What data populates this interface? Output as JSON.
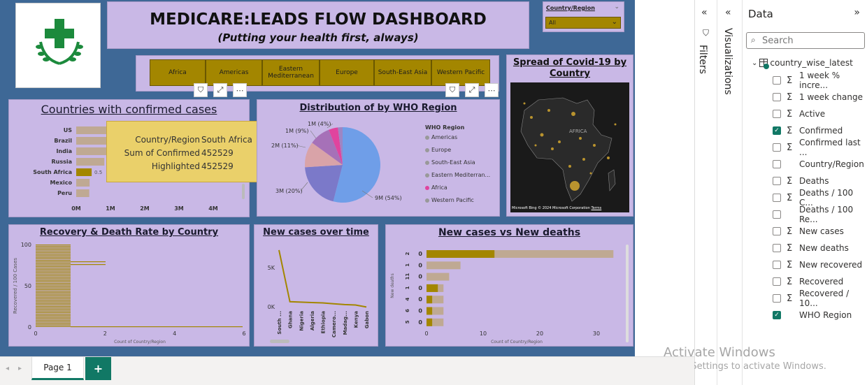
{
  "header": {
    "title": "MEDICARE:LEADS FLOW DASHBOARD",
    "subtitle": "(Putting your health first, always)"
  },
  "slicer": {
    "label": "Country/Region",
    "value": "All"
  },
  "regions": [
    "Africa",
    "Americas",
    "Eastern Mediterranean",
    "Europe",
    "South-East Asia",
    "Western Pacific"
  ],
  "map": {
    "title": "Spread of Covid-19 by Country",
    "map_label": "AFRICA",
    "credit": "Microsoft Bing",
    "copyright": "© 2024 Microsoft Corporation",
    "terms": "Terms"
  },
  "countries_chart": {
    "title": "Countries with confirmed cases",
    "type": "bar",
    "categories": [
      "US",
      "Brazil",
      "India",
      "Russia",
      "South Africa",
      "Mexico",
      "Peru"
    ],
    "ticks": [
      "0M",
      "1M",
      "2M",
      "3M",
      "4M"
    ],
    "highlight_label": "0.5",
    "tooltip": {
      "k1": "Country/Region",
      "v1": "South Africa",
      "k2": "Sum of Confirmed",
      "v2": "452529",
      "k3": "Highlighted",
      "v3": "452529"
    }
  },
  "pie_chart": {
    "title": "Distribution of by WHO Region",
    "legend_title": "WHO Region",
    "legend": [
      "Americas",
      "Europe",
      "South-East Asia",
      "Eastern Mediterran...",
      "Africa",
      "Western Pacific"
    ],
    "labels": [
      "1M (4%)",
      "1M (9%)",
      "2M (11%)",
      "3M (20%)",
      "9M (54%)"
    ]
  },
  "recovery_chart": {
    "title": "Recovery & Death Rate by Country",
    "ylabel": "Recovered / 100 Cases",
    "xlabel": "Count of Country/Region",
    "yticks": [
      "100",
      "50",
      "0"
    ],
    "xticks": [
      "0",
      "2",
      "4",
      "6"
    ]
  },
  "line_chart": {
    "title": "New cases over time",
    "yticks": [
      "5K",
      "0K"
    ],
    "categories": [
      "South ...",
      "Ghana",
      "Nigeria",
      "Algeria",
      "Ethiopia",
      "Camero...",
      "Madag...",
      "Kenya",
      "Gabon"
    ]
  },
  "newcases_chart": {
    "title": "New cases vs New deaths",
    "ylabel": "New deaths",
    "xlabel": "Count of Country/Region",
    "categories": [
      "0",
      "0",
      "0",
      "0",
      "0",
      "0",
      "0"
    ],
    "ylabels_side": [
      "2",
      "1",
      "11",
      "1",
      "4",
      "6",
      "5"
    ],
    "xticks": [
      "0",
      "10",
      "20",
      "30"
    ]
  },
  "chart_data": [
    {
      "type": "bar",
      "title": "Countries with confirmed cases",
      "categories": [
        "US",
        "Brazil",
        "India",
        "Russia",
        "South Africa",
        "Mexico",
        "Peru"
      ],
      "values": [
        4.3,
        2.4,
        1.4,
        0.82,
        0.45,
        0.39,
        0.38
      ],
      "highlighted": [
        0,
        0,
        0,
        0,
        0.45,
        0,
        0
      ],
      "xlim": [
        0,
        4.5
      ]
    },
    {
      "type": "pie",
      "title": "Distribution of by WHO Region",
      "categories": [
        "Americas",
        "Europe",
        "South-East Asia",
        "Eastern Mediterranean",
        "Africa",
        "Western Pacific"
      ],
      "values": [
        54,
        20,
        11,
        9,
        4,
        2
      ],
      "colors": [
        "#6f9ee8",
        "#7b79c9",
        "#d9a3a8",
        "#a671b8",
        "#e0449e",
        "#9d86c4"
      ]
    },
    {
      "type": "line",
      "title": "New cases over time",
      "categories": [
        "South ...",
        "Ghana",
        "Nigeria",
        "Algeria",
        "Ethiopia",
        "Camero...",
        "Madag...",
        "Kenya",
        "Gabon"
      ],
      "values": [
        7000,
        700,
        650,
        600,
        550,
        450,
        350,
        300,
        50
      ],
      "ylim": [
        0,
        7500
      ]
    },
    {
      "type": "bar",
      "title": "New cases vs New deaths",
      "categories": [
        "0",
        "0",
        "0",
        "0",
        "0",
        "0",
        "0"
      ],
      "total": [
        33,
        6,
        4,
        3,
        3,
        3,
        3
      ],
      "highlighted": [
        12,
        0,
        0,
        2,
        1,
        1,
        1
      ],
      "xlim": [
        0,
        35
      ]
    }
  ],
  "filters_label": "Filters",
  "visualizations_label": "Visualizations",
  "data_pane": {
    "title": "Data",
    "search_placeholder": "Search",
    "table": "country_wise_latest",
    "fields": [
      {
        "name": "1 week % incre...",
        "sigma": true,
        "checked": false
      },
      {
        "name": "1 week change",
        "sigma": true,
        "checked": false
      },
      {
        "name": "Active",
        "sigma": true,
        "checked": false
      },
      {
        "name": "Confirmed",
        "sigma": true,
        "checked": true
      },
      {
        "name": "Confirmed last ...",
        "sigma": true,
        "checked": false
      },
      {
        "name": "Country/Region",
        "sigma": false,
        "checked": false
      },
      {
        "name": "Deaths",
        "sigma": true,
        "checked": false
      },
      {
        "name": "Deaths / 100 C...",
        "sigma": true,
        "checked": false
      },
      {
        "name": "Deaths / 100 Re...",
        "sigma": false,
        "checked": false
      },
      {
        "name": "New cases",
        "sigma": true,
        "checked": false
      },
      {
        "name": "New deaths",
        "sigma": true,
        "checked": false
      },
      {
        "name": "New recovered",
        "sigma": true,
        "checked": false
      },
      {
        "name": "Recovered",
        "sigma": true,
        "checked": false
      },
      {
        "name": "Recovered / 10...",
        "sigma": true,
        "checked": false
      },
      {
        "name": "WHO Region",
        "sigma": false,
        "checked": true
      }
    ]
  },
  "watermark": {
    "line1": "Activate Windows",
    "line2": "Go to Settings to activate Windows."
  },
  "tabs": {
    "page1": "Page 1",
    "add": "+"
  }
}
